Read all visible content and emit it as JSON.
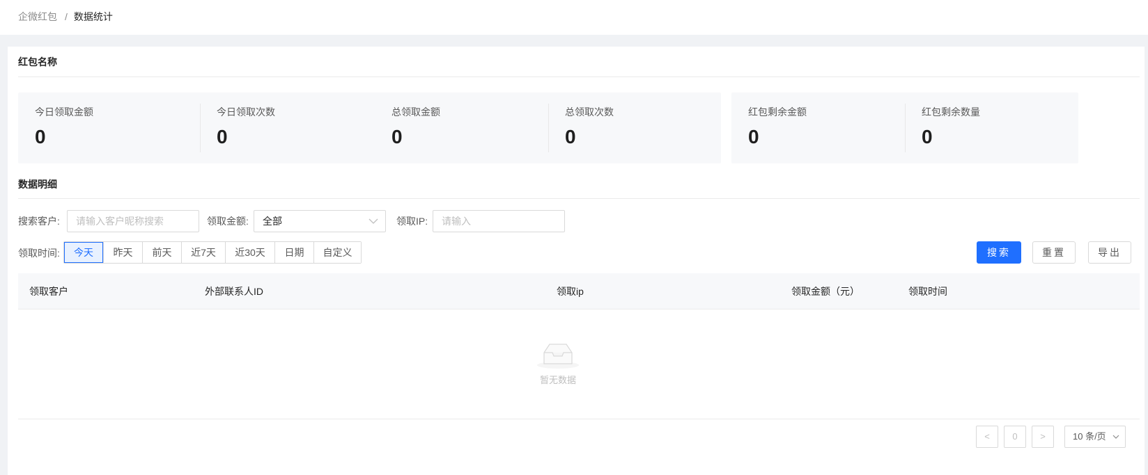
{
  "breadcrumb": {
    "parent": "企微红包",
    "separator": "/",
    "current": "数据统计"
  },
  "summary_section": {
    "title": "红包名称",
    "groups": [
      {
        "items": [
          {
            "label": "今日领取金额",
            "value": "0"
          },
          {
            "label": "今日领取次数",
            "value": "0"
          }
        ]
      },
      {
        "items": [
          {
            "label": "总领取金额",
            "value": "0"
          },
          {
            "label": "总领取次数",
            "value": "0"
          }
        ]
      },
      {
        "items": [
          {
            "label": "红包剩余金额",
            "value": "0"
          },
          {
            "label": "红包剩余数量",
            "value": "0"
          }
        ]
      }
    ]
  },
  "detail_section": {
    "title": "数据明细",
    "filters": {
      "customer_label": "搜索客户:",
      "customer_placeholder": "请输入客户昵称搜索",
      "amount_label": "领取金额:",
      "amount_value": "全部",
      "ip_label": "领取IP:",
      "ip_placeholder": "请输入",
      "time_label": "领取时间:",
      "time_options": [
        "今天",
        "昨天",
        "前天",
        "近7天",
        "近30天",
        "日期",
        "自定义"
      ],
      "time_selected": "今天"
    },
    "actions": {
      "search": "搜索",
      "reset": "重置",
      "export": "导出"
    },
    "table": {
      "columns": [
        "领取客户",
        "外部联系人ID",
        "领取ip",
        "领取金额（元）",
        "领取时间"
      ],
      "rows": [],
      "empty_text": "暂无数据"
    },
    "pagination": {
      "prev": "<",
      "current_page": "0",
      "next": ">",
      "page_size": "10 条/页"
    }
  },
  "colors": {
    "primary": "#1f6fff",
    "background": "#f0f2f5",
    "panel": "#f7f8fa"
  },
  "icons": {
    "empty": "empty-inbox-icon",
    "dropdown": "chevron-down-icon"
  }
}
